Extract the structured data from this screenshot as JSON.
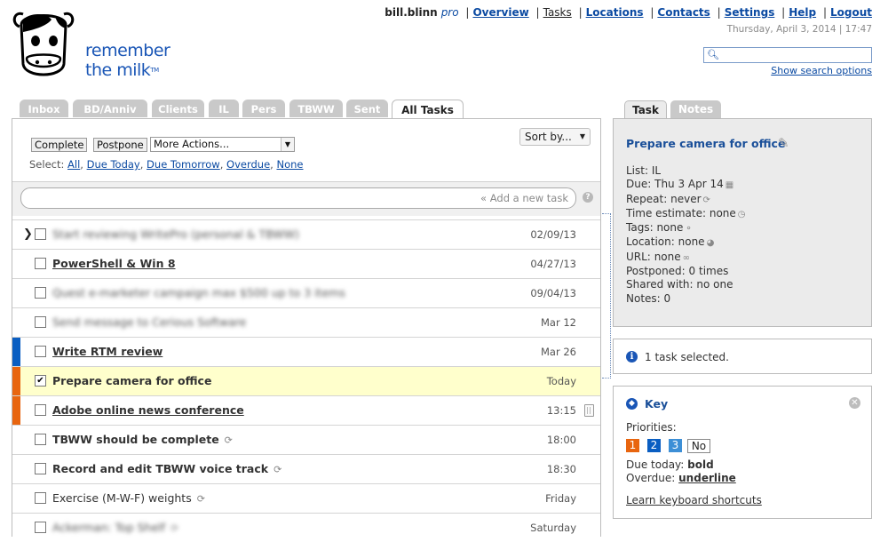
{
  "header": {
    "logo_alt": "remember the milk",
    "logo_line1": "remember",
    "logo_line2": "the milk",
    "logo_tm": "TM",
    "user": "bill.blinn",
    "plan": "pro",
    "nav": [
      "Overview",
      "Tasks",
      "Locations",
      "Contacts",
      "Settings",
      "Help",
      "Logout"
    ],
    "current_nav": "Tasks",
    "datetime": "Thursday, April 3, 2014 | 17:47",
    "search_value": "",
    "search_options_label": "Show search options"
  },
  "list_tabs": [
    "Inbox",
    "BD/Anniv",
    "Clients",
    "IL",
    "Pers",
    "TBWW",
    "Sent",
    "All Tasks"
  ],
  "active_list_tab": "All Tasks",
  "toolbar": {
    "complete_label": "Complete",
    "postpone_label": "Postpone",
    "more_actions_label": "More Actions...",
    "sort_label": "Sort by...",
    "select_prefix": "Select:",
    "select_links": [
      "All",
      "Due Today",
      "Due Tomorrow",
      "Overdue",
      "None"
    ],
    "add_task_placeholder": "« Add a new task",
    "help_label": "?"
  },
  "tasks": [
    {
      "name": "Start reviewing WritePro (personal & TBWW)",
      "due": "02/09/13",
      "blurred": true,
      "current": true
    },
    {
      "name": "PowerShell & Win 8",
      "due": "04/27/13"
    },
    {
      "name": "Quest e-marketer campaign max $500 up to 3 items",
      "due": "09/04/13",
      "blurred": true
    },
    {
      "name": "Send message to Cerious Software",
      "due": "Mar 12",
      "blurred": true
    },
    {
      "name": "Write RTM review",
      "due": "Mar 26",
      "priority_color": "#0a5ec2"
    },
    {
      "name": "Prepare camera for office",
      "due": "Today",
      "priority_color": "#e8650f",
      "checked": true,
      "selected": true
    },
    {
      "name": "Adobe online news conference",
      "due": "13:15",
      "priority_color": "#e8650f",
      "trash": true
    },
    {
      "name": "TBWW should be complete",
      "due": "18:00",
      "repeat": true
    },
    {
      "name": "Record and edit TBWW voice track",
      "due": "18:30",
      "repeat": true
    },
    {
      "name": "Exercise (M-W-F) weights",
      "due": "Friday",
      "repeat": true
    },
    {
      "name": "Ackerman: Top Shelf",
      "due": "Saturday",
      "blurred": true,
      "repeat": true
    }
  ],
  "detail": {
    "tabs": [
      "Task",
      "Notes"
    ],
    "active_tab": "Task",
    "title": "Prepare camera for office",
    "props": [
      {
        "label": "List:",
        "value": "IL",
        "icon": ""
      },
      {
        "label": "Due:",
        "value": "Thu 3 Apr 14",
        "icon": "calendar-icon"
      },
      {
        "label": "Repeat:",
        "value": "never",
        "icon": "repeat-icon"
      },
      {
        "label": "Time estimate:",
        "value": "none",
        "icon": "clock-icon"
      },
      {
        "label": "Tags:",
        "value": "none",
        "icon": "tag-icon"
      },
      {
        "label": "Location:",
        "value": "none",
        "icon": "globe-icon"
      },
      {
        "label": "URL:",
        "value": "none",
        "icon": "link-icon"
      },
      {
        "label": "Postponed:",
        "value": "0 times",
        "icon": ""
      },
      {
        "label": "Shared with:",
        "value": "no one",
        "icon": ""
      },
      {
        "label": "Notes:",
        "value": "0",
        "icon": ""
      }
    ]
  },
  "selection": {
    "text": "1 task selected."
  },
  "key": {
    "title": "Key",
    "priorities_label": "Priorities:",
    "priorities": [
      {
        "label": "1",
        "color": "#e8650f"
      },
      {
        "label": "2",
        "color": "#0a5ec2"
      },
      {
        "label": "3",
        "color": "#3d8fd6"
      },
      {
        "label": "No",
        "color": "#ffffff"
      }
    ],
    "due_today_label": "Due today:",
    "due_today_value": "bold",
    "overdue_label": "Overdue:",
    "overdue_value": "underline",
    "shortcuts_link": "Learn keyboard shortcuts"
  }
}
